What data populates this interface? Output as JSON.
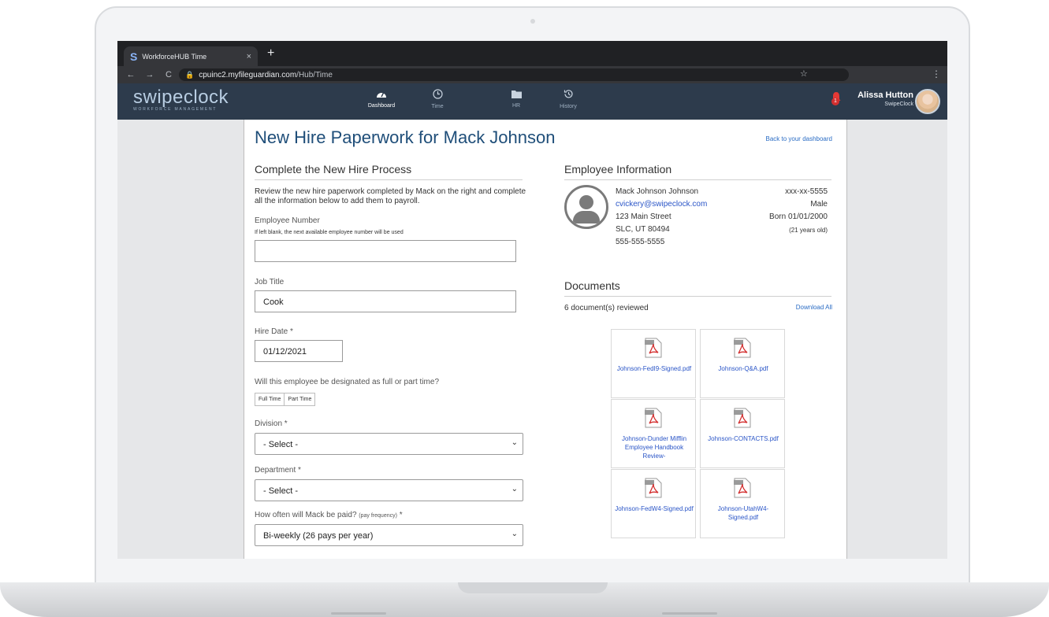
{
  "browser": {
    "tab_title": "WorkforceHUB Time",
    "tab_close": "×",
    "new_tab": "+",
    "url_host": "cpuinc2.myfileguardian.com",
    "url_path": "/Hub/Time"
  },
  "app": {
    "brand": "swipeclock",
    "brand_sub": "WORKFORCE MANAGEMENT",
    "nav": [
      {
        "label": "Dashboard",
        "icon": "dashboard-icon"
      },
      {
        "label": "Time",
        "icon": "clock-icon"
      },
      {
        "label": "HR",
        "icon": "folder-icon"
      },
      {
        "label": "History",
        "icon": "history-icon"
      }
    ],
    "notification_count": "1",
    "user_name": "Alissa Hutton",
    "user_org": "SwipeClock"
  },
  "page": {
    "title": "New Hire Paperwork for Mack Johnson",
    "back_link": "Back to your dashboard"
  },
  "form": {
    "section_title": "Complete the New Hire Process",
    "intro": "Review the new hire paperwork completed by Mack on the right and complete all the information below to add them to payroll.",
    "employee_number_label": "Employee Number",
    "employee_number_hint": "If left blank, the next available employee number will be used",
    "employee_number_value": "",
    "job_title_label": "Job Title",
    "job_title_value": "Cook",
    "hire_date_label": "Hire Date *",
    "hire_date_value": "01/12/2021",
    "full_part_question": "Will this employee be designated as full or part time?",
    "full_time_label": "Full Time",
    "part_time_label": "Part Time",
    "division_label": "Division *",
    "division_value": "- Select -",
    "department_label": "Department *",
    "department_value": "- Select -",
    "pay_question": "How often will Mack be paid?",
    "pay_question_sub": "(pay frequency)",
    "pay_question_req": " *",
    "pay_value": "Bi-weekly (26 pays per year)"
  },
  "employee": {
    "section_title": "Employee Information",
    "name": "Mack Johnson Johnson",
    "email": "cvickery@swipeclock.com",
    "street": "123 Main Street",
    "city": "SLC, UT 80494",
    "phone": "555-555-5555",
    "ssn": "xxx-xx-5555",
    "gender": "Male",
    "born": "Born 01/01/2000",
    "age": "(21 years old)"
  },
  "documents": {
    "section_title": "Documents",
    "reviewed": "6 document(s) reviewed",
    "download_all": "Download All",
    "files": [
      "Johnson-FedI9-Signed.pdf",
      "Johnson-Q&A.pdf",
      "Johnson-Dunder Mifflin Employee Handbook Review-",
      "Johnson-CONTACTS.pdf",
      "Johnson-FedW4-Signed.pdf",
      "Johnson-UtahW4-Signed.pdf"
    ]
  }
}
